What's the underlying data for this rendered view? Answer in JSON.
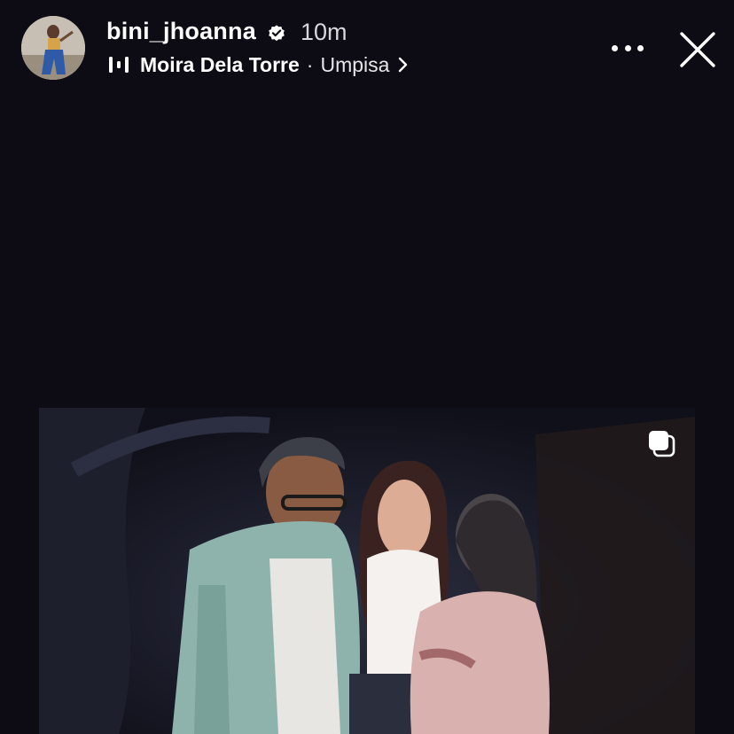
{
  "header": {
    "username": "bini_jhoanna",
    "time": "10m",
    "music": {
      "artist": "Moira Dela Torre",
      "separator": "·",
      "song": "Umpisa"
    }
  },
  "icons": {
    "verified": "verified-badge-icon",
    "music": "music-bars-icon",
    "chevron": "chevron-right-icon",
    "more": "more-options-icon",
    "close": "close-icon",
    "multi": "multiple-photos-icon"
  },
  "colors": {
    "background": "#0d0c14",
    "text": "#ffffff",
    "secondary_text": "#d7d6db"
  }
}
